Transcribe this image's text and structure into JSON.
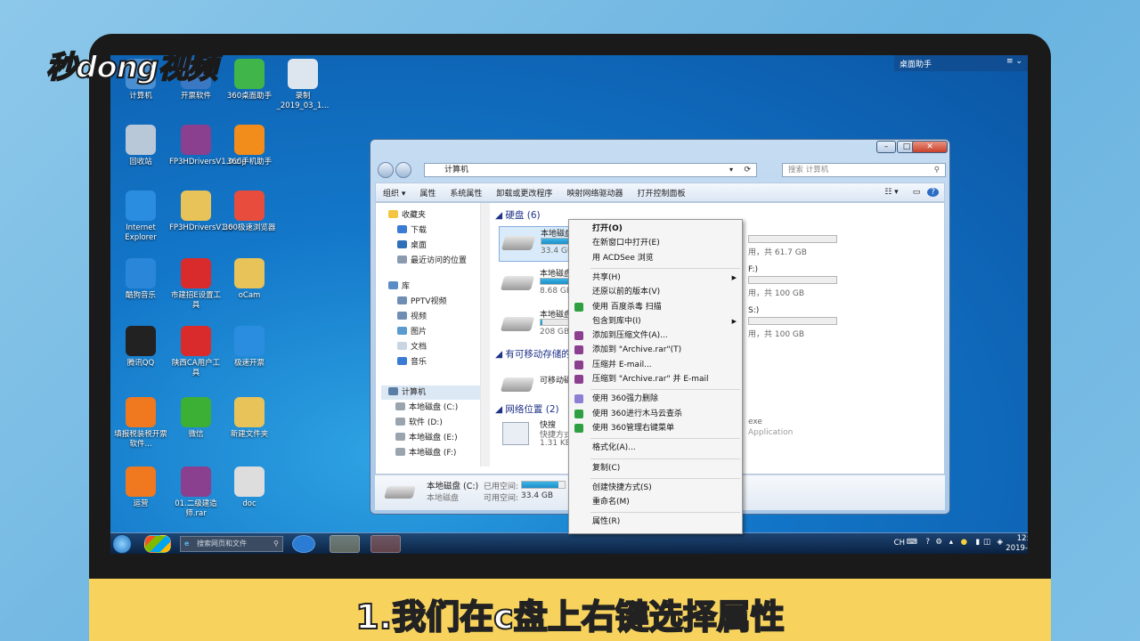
{
  "watermark": "秒dong视频",
  "caption": "1.我们在c盘上右键选择属性",
  "desktop_icons": [
    {
      "label": "计算机",
      "icon": "computer-icon",
      "color": "#4a8fd1"
    },
    {
      "label": "开票软件",
      "icon": "software-icon",
      "color": "#3b78c4"
    },
    {
      "label": "360桌面助手",
      "icon": "desktop-helper-icon",
      "color": "#3fb54a"
    },
    {
      "label": "录制_2019_03_1...",
      "icon": "recording-file-icon",
      "color": "#dde6ef"
    },
    {
      "label": "回收站",
      "icon": "recycle-bin-icon",
      "color": "#b8c8d8"
    },
    {
      "label": "FP3HDriversV1.0.zip",
      "icon": "winrar-archive-icon",
      "color": "#8a3f8f"
    },
    {
      "label": "360手机助手",
      "icon": "phone-helper-icon",
      "color": "#f28c1b"
    },
    {
      "label": "Internet Explorer",
      "icon": "ie-icon",
      "color": "#2b8de0"
    },
    {
      "label": "FP3HDriversV1.0",
      "icon": "folder-icon",
      "color": "#e8c35a"
    },
    {
      "label": "360极速浏览器",
      "icon": "browser-icon",
      "color": "#e84c3d"
    },
    {
      "label": "酷狗音乐",
      "icon": "kugou-icon",
      "color": "#2a86d8"
    },
    {
      "label": "市建招E设置工具",
      "icon": "setup-tool-icon",
      "color": "#d92b2b"
    },
    {
      "label": "oCam",
      "icon": "folder-icon",
      "color": "#e8c35a"
    },
    {
      "label": "腾讯QQ",
      "icon": "qq-icon",
      "color": "#222222"
    },
    {
      "label": "陕西CA用户工具",
      "icon": "ca-tool-icon",
      "color": "#d92b2b"
    },
    {
      "label": "极速开票",
      "icon": "invoice-icon",
      "color": "#2b8de0"
    },
    {
      "label": "填报税装税开票软件...",
      "icon": "tax-software-icon",
      "color": "#f0781e"
    },
    {
      "label": "微信",
      "icon": "wechat-icon",
      "color": "#3cb034"
    },
    {
      "label": "新建文件夹",
      "icon": "folder-icon",
      "color": "#e8c35a"
    },
    {
      "label": "运营",
      "icon": "operations-icon",
      "color": "#f0781e"
    },
    {
      "label": "01.二级建造师.rar",
      "icon": "winrar-archive-icon",
      "color": "#8a3f8f"
    },
    {
      "label": "doc",
      "icon": "folder-icon",
      "color": "#dddddd"
    }
  ],
  "gadget": {
    "title": "桌面助手",
    "menu": "≡ ⌄"
  },
  "window": {
    "address": "计算机",
    "search_placeholder": "搜索 计算机",
    "toolbar": [
      "组织 ▾",
      "属性",
      "系统属性",
      "卸载或更改程序",
      "映射网络驱动器",
      "打开控制面板"
    ],
    "nav": {
      "favorites": "收藏夹",
      "downloads": "下载",
      "desktop": "桌面",
      "recent": "最近访问的位置",
      "libraries": "库",
      "pptv": "PPTV视频",
      "videos": "视频",
      "pictures": "图片",
      "documents": "文档",
      "music": "音乐",
      "computer": "计算机",
      "drive_c": "本地磁盘 (C:)",
      "drive_d": "软件 (D:)",
      "drive_e": "本地磁盘 (E:)",
      "drive_f": "本地磁盘 (F:)"
    },
    "groups": {
      "hard_disks": "硬盘 (6)",
      "removable": "有可移动存储的",
      "network": "网络位置 (2)"
    },
    "drives": [
      {
        "name": "本地磁盘",
        "free": "33.4 GB",
        "used_fraction": 0.85
      },
      {
        "name": "本地磁盘",
        "free": "8.68 GB",
        "used_fraction": 0.9
      },
      {
        "name": "本地磁盘",
        "free": "208 GB",
        "used_fraction": 0.05
      }
    ],
    "right_drives": [
      {
        "letter": "",
        "space": "用，共 61.7 GB"
      },
      {
        "letter": "F:)",
        "space": "用，共 100 GB"
      },
      {
        "letter": "S:)",
        "space": "用，共 100 GB"
      }
    ],
    "removable_item": "可移动磁盘",
    "network_item": {
      "name": "快搜",
      "type": "快捷方式",
      "size": "1.31 KB"
    },
    "network_right": [
      "exe",
      "Application"
    ],
    "details": {
      "name": "本地磁盘 (C:)",
      "used_label": "已用空间:",
      "free_label": "可用空间:",
      "free_value": "33.4 GB",
      "type": "本地磁盘",
      "used_fraction": 0.85
    }
  },
  "context_menu": [
    {
      "label": "打开(O)",
      "bold": true
    },
    {
      "label": "在新窗口中打开(E)"
    },
    {
      "label": "用 ACDSee 浏览"
    },
    {
      "sep": true
    },
    {
      "label": "共享(H)",
      "submenu": true
    },
    {
      "label": "还原以前的版本(V)"
    },
    {
      "label": "使用 百度杀毒 扫描",
      "icon": "shield-icon",
      "color": "#2ea042"
    },
    {
      "label": "包含到库中(I)",
      "submenu": true
    },
    {
      "label": "添加到压缩文件(A)...",
      "icon": "winrar-icon",
      "color": "#8a3f8f"
    },
    {
      "label": "添加到 \"Archive.rar\"(T)",
      "icon": "winrar-icon",
      "color": "#8a3f8f"
    },
    {
      "label": "压缩并 E-mail...",
      "icon": "winrar-icon",
      "color": "#8a3f8f"
    },
    {
      "label": "压缩到 \"Archive.rar\" 并 E-mail",
      "icon": "winrar-icon",
      "color": "#8a3f8f"
    },
    {
      "sep": true
    },
    {
      "label": "使用 360强力删除",
      "icon": "delete-icon",
      "color": "#8f7fd4"
    },
    {
      "label": "使用 360进行木马云查杀",
      "icon": "trojan-scan-icon",
      "color": "#2ea042"
    },
    {
      "label": "使用 360管理右键菜单",
      "icon": "menu-manage-icon",
      "color": "#2ea042"
    },
    {
      "sep": true
    },
    {
      "label": "格式化(A)..."
    },
    {
      "sep": true
    },
    {
      "label": "复制(C)"
    },
    {
      "sep": true
    },
    {
      "label": "创建快捷方式(S)"
    },
    {
      "label": "重命名(M)"
    },
    {
      "sep": true
    },
    {
      "label": "属性(R)"
    }
  ],
  "taskbar": {
    "search_placeholder": "搜索网页和文件",
    "tray": "CH",
    "time": "12:02",
    "date": "2019-03-15"
  }
}
